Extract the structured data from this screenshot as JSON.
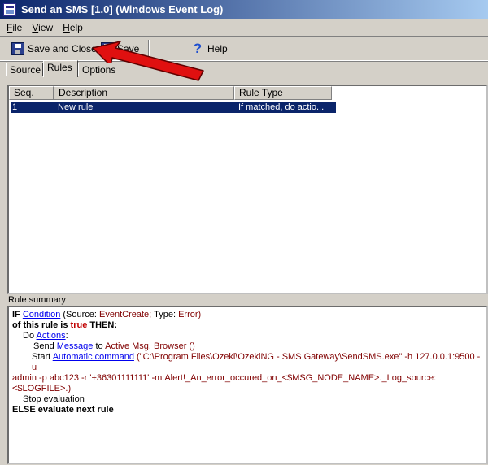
{
  "window": {
    "title": "Send an SMS [1.0] (Windows Event Log)"
  },
  "menu": [
    "File",
    "View",
    "Help"
  ],
  "toolbar": {
    "save_close_label": "Save and Close",
    "save_label": "Save",
    "help_label": "Help"
  },
  "tabs": [
    "Source",
    "Rules",
    "Options"
  ],
  "list": {
    "columns": [
      "Seq.",
      "Description",
      "Rule Type"
    ],
    "rows": [
      {
        "seq": "1",
        "description": "New rule",
        "rule_type": "If matched, do actio..."
      }
    ]
  },
  "summary": {
    "label": "Rule summary",
    "if_kw": "IF",
    "condition_link": "Condition",
    "source_label": "(Source:",
    "source_value": "EventCreate;",
    "type_label": "Type:",
    "type_value": "Error)",
    "of_rule_kw": "of this rule is",
    "true_kw": "true",
    "then_kw": "THEN:",
    "do_label": "Do",
    "actions_link": "Actions",
    "actions_colon": ":",
    "send_label": "Send",
    "message_link": "Message",
    "to_label": "to",
    "send_target": "Active Msg. Browser ()",
    "start_label": "Start",
    "command_link": "Automatic command",
    "command_text": "(\"C:\\Program Files\\Ozeki\\OzekiNG - SMS Gateway\\SendSMS.exe\" -h 127.0.0.1:9500 -u",
    "command_text2": "admin -p abc123 -r '+36301111111' -m:Alert!_An_error_occured_on_<$MSG_NODE_NAME>._Log_source:<$LOGFILE>.)",
    "stop_label": "Stop evaluation",
    "else_kw": "ELSE evaluate next rule"
  }
}
